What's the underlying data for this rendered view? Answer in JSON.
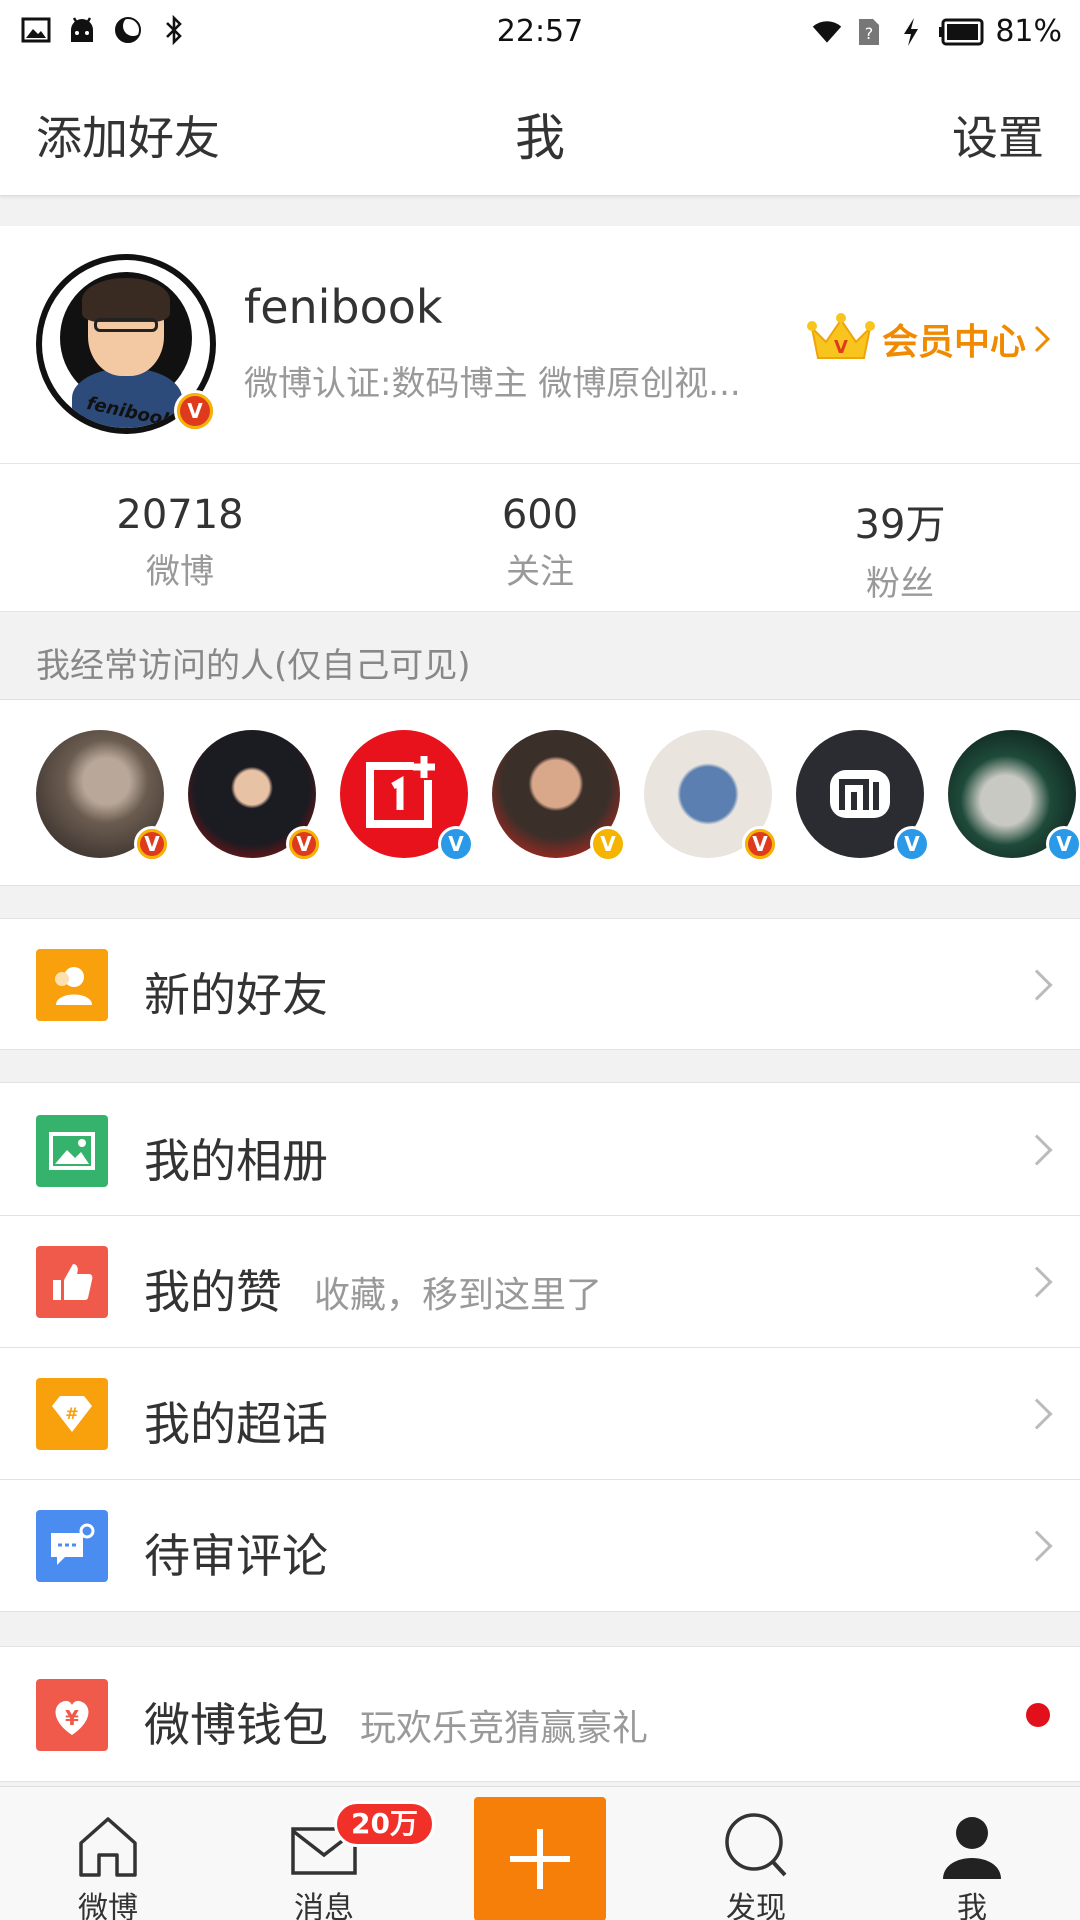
{
  "status_bar": {
    "time": "22:57",
    "battery_percent": "81%",
    "icons_left": [
      "image-icon",
      "android-icon",
      "moon-icon",
      "bluetooth-icon"
    ],
    "icons_right": [
      "wifi-icon",
      "no-sim-icon",
      "charging-icon",
      "battery-icon"
    ]
  },
  "nav": {
    "left": "添加好友",
    "title": "我",
    "right": "设置"
  },
  "profile": {
    "avatar_text": "fenibook",
    "username": "fenibook",
    "verification": "微博认证:数码博主 微博原创视...",
    "vip_label": "会员中心"
  },
  "stats": [
    {
      "value": "20718",
      "label": "微博"
    },
    {
      "value": "600",
      "label": "关注"
    },
    {
      "value": "39万",
      "label": "粉丝"
    }
  ],
  "frequent_visitors": {
    "title": "我经常访问的人(仅自己可见)",
    "avatars": [
      {
        "badge": "V",
        "badge_type": "gold"
      },
      {
        "badge": "V",
        "badge_type": "gold"
      },
      {
        "badge": "V",
        "badge_type": "blue"
      },
      {
        "badge": "V",
        "badge_type": "yellow"
      },
      {
        "badge": "V",
        "badge_type": "gold"
      },
      {
        "badge": "V",
        "badge_type": "blue"
      },
      {
        "badge": "V",
        "badge_type": "blue"
      }
    ]
  },
  "menu": [
    {
      "label": "新的好友",
      "sub": "",
      "icon": "person-icon",
      "color": "#f8a10d"
    },
    {
      "label": "我的相册",
      "sub": "",
      "icon": "photo-icon",
      "color": "#35b36c"
    },
    {
      "label": "我的赞",
      "sub": "收藏，移到这里了",
      "icon": "thumbs-up-icon",
      "color": "#f05a4a"
    },
    {
      "label": "我的超话",
      "sub": "",
      "icon": "diamond-hash-icon",
      "color": "#f8a10d"
    },
    {
      "label": "待审评论",
      "sub": "",
      "icon": "comment-gear-icon",
      "color": "#4a8cf0"
    },
    {
      "label": "微博钱包",
      "sub": "玩欢乐竞猜赢豪礼",
      "icon": "yuan-wallet-icon",
      "color": "#f05a4a"
    }
  ],
  "tabbar": {
    "tabs": [
      {
        "label": "微博",
        "icon": "home-icon"
      },
      {
        "label": "消息",
        "icon": "mail-icon",
        "badge": "20万"
      },
      {
        "label": "发现",
        "icon": "search-icon"
      },
      {
        "label": "我",
        "icon": "person-icon"
      }
    ],
    "compose_icon": "plus-icon"
  },
  "colors": {
    "accent": "#f67f0a",
    "vip": "#f08a00",
    "badge_red": "#f2302a"
  }
}
